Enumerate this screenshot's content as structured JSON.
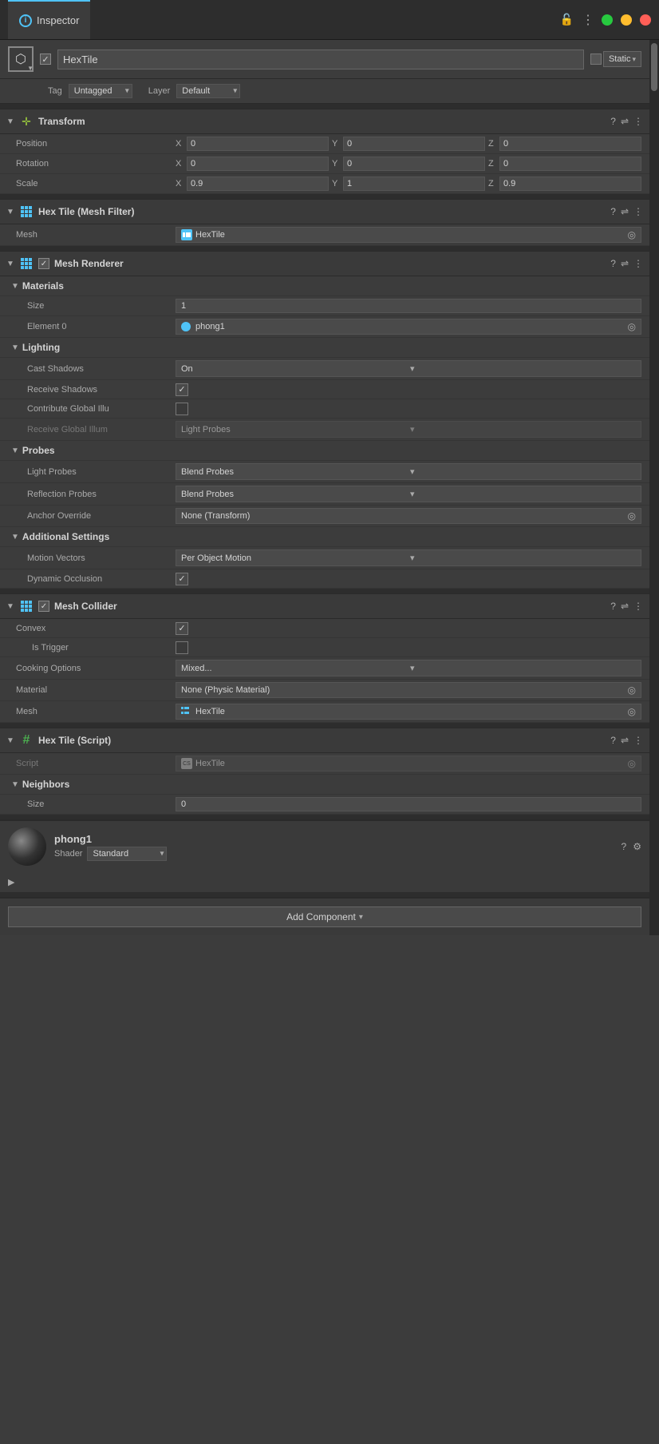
{
  "titleBar": {
    "tabLabel": "Inspector",
    "tabIcon": "i"
  },
  "objectHeader": {
    "checkmark": "✓",
    "name": "HexTile",
    "staticLabel": "Static",
    "tagLabel": "Tag",
    "tagValue": "Untagged",
    "layerLabel": "Layer",
    "layerValue": "Default"
  },
  "transform": {
    "title": "Transform",
    "position": {
      "label": "Position",
      "x": "0",
      "y": "0",
      "z": "0"
    },
    "rotation": {
      "label": "Rotation",
      "x": "0",
      "y": "0",
      "z": "0"
    },
    "scale": {
      "label": "Scale",
      "x": "0.9",
      "y": "1",
      "z": "0.9"
    }
  },
  "meshFilter": {
    "title": "Hex Tile (Mesh Filter)",
    "meshLabel": "Mesh",
    "meshValue": "HexTile"
  },
  "meshRenderer": {
    "title": "Mesh Renderer",
    "checkmark": "✓",
    "materials": {
      "title": "Materials",
      "sizeLabel": "Size",
      "sizeValue": "1",
      "element0Label": "Element 0",
      "element0Value": "phong1"
    },
    "lighting": {
      "title": "Lighting",
      "castShadowsLabel": "Cast Shadows",
      "castShadowsValue": "On",
      "receiveShadowsLabel": "Receive Shadows",
      "contributeGILabel": "Contribute Global Illu",
      "receiveGILabel": "Receive Global Illum",
      "receiveGIValue": "Light Probes"
    },
    "probes": {
      "title": "Probes",
      "lightProbesLabel": "Light Probes",
      "lightProbesValue": "Blend Probes",
      "reflectionProbesLabel": "Reflection Probes",
      "reflectionProbesValue": "Blend Probes",
      "anchorOverrideLabel": "Anchor Override",
      "anchorOverrideValue": "None (Transform)"
    },
    "additionalSettings": {
      "title": "Additional Settings",
      "motionVectorsLabel": "Motion Vectors",
      "motionVectorsValue": "Per Object Motion",
      "dynamicOcclusionLabel": "Dynamic Occlusion"
    }
  },
  "meshCollider": {
    "title": "Mesh Collider",
    "checkmark": "✓",
    "convexLabel": "Convex",
    "isTriggerLabel": "Is Trigger",
    "cookingOptionsLabel": "Cooking Options",
    "cookingOptionsValue": "Mixed...",
    "materialLabel": "Material",
    "materialValue": "None (Physic Material)",
    "meshLabel": "Mesh",
    "meshValue": "HexTile"
  },
  "hexTileScript": {
    "title": "Hex Tile (Script)",
    "scriptLabel": "Script",
    "scriptValue": "HexTile",
    "neighbors": {
      "title": "Neighbors",
      "sizeLabel": "Size",
      "sizeValue": "0"
    }
  },
  "materialPreview": {
    "name": "phong1",
    "shaderLabel": "Shader",
    "shaderValue": "Standard",
    "expandLabel": "▶"
  },
  "addComponent": {
    "label": "Add Component"
  }
}
